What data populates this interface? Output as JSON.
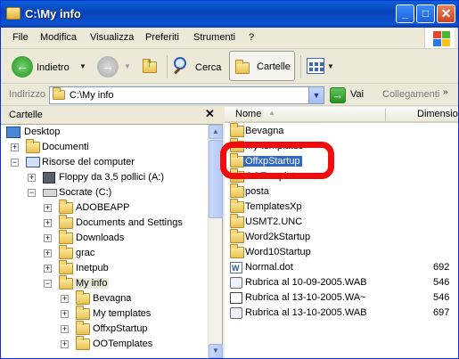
{
  "window": {
    "title": "C:\\My info"
  },
  "menu": [
    "File",
    "Modifica",
    "Visualizza",
    "Preferiti",
    "Strumenti",
    "?"
  ],
  "toolbar": {
    "back_label": "Indietro",
    "search_label": "Cerca",
    "folders_label": "Cartelle"
  },
  "address": {
    "label": "Indirizzo",
    "value": "C:\\My info",
    "go_label": "Vai",
    "links_label": "Collegamenti"
  },
  "folders_pane": {
    "title": "Cartelle",
    "items": [
      {
        "label": "Desktop"
      },
      {
        "label": "Documenti"
      },
      {
        "label": "Risorse del computer"
      },
      {
        "label": "Floppy da 3,5 pollici (A:)"
      },
      {
        "label": "Socrate (C:)"
      },
      {
        "label": "ADOBEAPP"
      },
      {
        "label": "Documents and Settings"
      },
      {
        "label": "Downloads"
      },
      {
        "label": "grac"
      },
      {
        "label": "Inetpub"
      },
      {
        "label": "My info"
      },
      {
        "label": "Bevagna"
      },
      {
        "label": "My templates"
      },
      {
        "label": "OffxpStartup"
      },
      {
        "label": "OOTemplates"
      }
    ]
  },
  "file_list": {
    "columns": {
      "name": "Nome",
      "size": "Dimensio"
    },
    "rows": [
      {
        "name": "Bevagna",
        "size": ""
      },
      {
        "name": "My templates",
        "size": ""
      },
      {
        "name": "OffxpStartup",
        "size": ""
      },
      {
        "name": "OOTemplates",
        "size": ""
      },
      {
        "name": "posta",
        "size": ""
      },
      {
        "name": "TemplatesXp",
        "size": ""
      },
      {
        "name": "USMT2.UNC",
        "size": ""
      },
      {
        "name": "Word2kStartup",
        "size": ""
      },
      {
        "name": "Word10Startup",
        "size": ""
      },
      {
        "name": "Normal.dot",
        "size": "692"
      },
      {
        "name": "Rubrica al 10-09-2005.WAB",
        "size": "546"
      },
      {
        "name": "Rubrica al 13-10-2005.WA~",
        "size": "546"
      },
      {
        "name": "Rubrica al 13-10-2005.WAB",
        "size": "697"
      }
    ],
    "selected": "OffxpStartup"
  },
  "colors": {
    "selection": "#316ac5",
    "highlight_ring": "#f00c0c",
    "titlebar": "#0842b8"
  }
}
